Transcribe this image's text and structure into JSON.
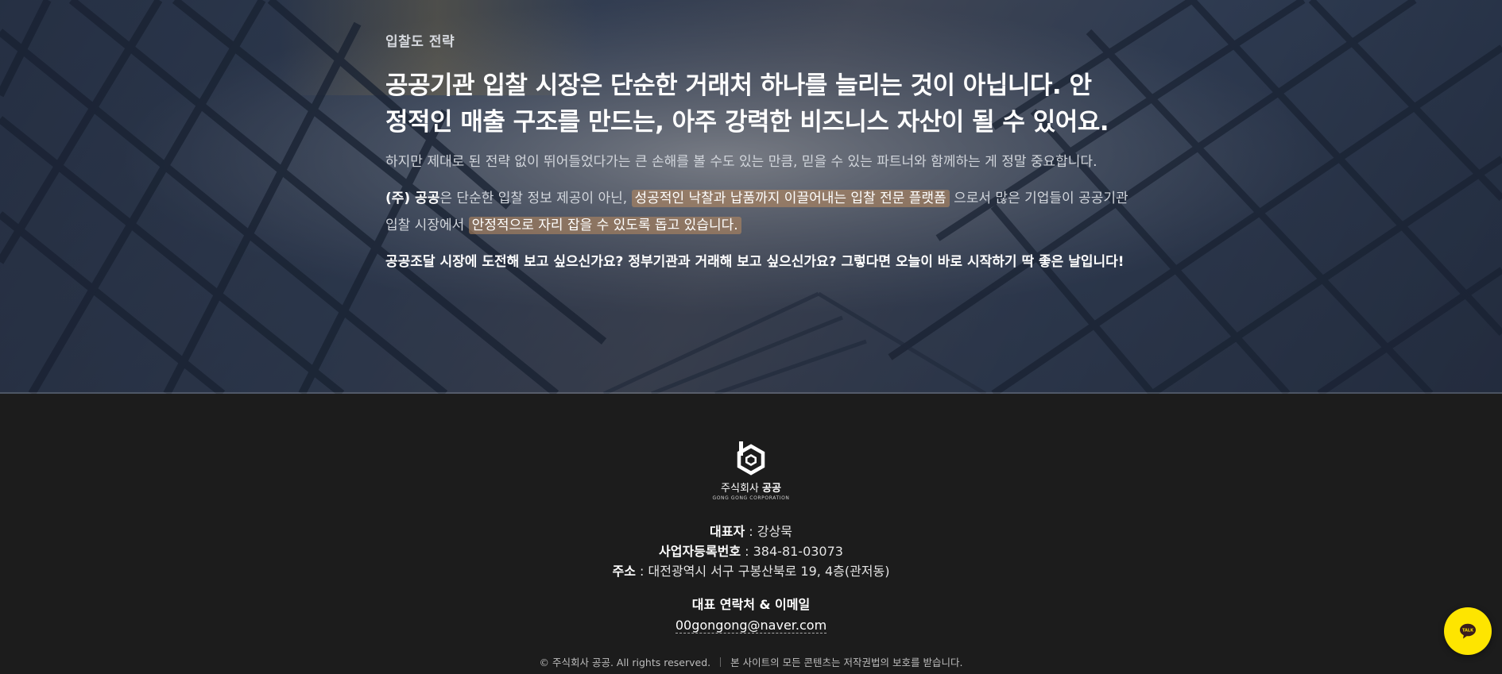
{
  "hero": {
    "eyebrow": "입찰도 전략",
    "headline_line1": "공공기관 입찰 시장은 단순한 거래처 하나를 늘리는 것이 아닙니다. 안",
    "headline_line2": "정적인 매출 구조를 만드는, 아주 강력한 비즈니스 자산이 될 수 있어요.",
    "subtext": "하지만 제대로 된 전략 없이 뛰어들었다가는 큰 손해를 볼 수도 있는 만큼, 믿을 수 있는 파트너와 함께하는 게 정말 중요합니다.",
    "para_company": "(주) 공공",
    "para_part1": "은 단순한 입찰 정보 제공이 아닌,",
    "para_highlight1": "성공적인 낙찰과 납품까지 이끌어내는 입찰 전문 플랫폼",
    "para_part2": "으로서 많은 기업들이 공공기관",
    "para_part3": "입찰 시장에서",
    "para_highlight2": "안정적으로 자리 잡을 수 있도록 돕고 있습니다.",
    "cta": "공공조달 시장에 도전해 보고 싶으신가요? 정부기관과 거래해 보고 싶으신가요? 그렇다면 오늘이 바로 시작하기 딱 좋은 날입니다!"
  },
  "footer": {
    "logo_name_prefix": "주식회사",
    "logo_name_bold": "공공",
    "logo_sub": "GONG GONG CORPORATION",
    "ceo_label": "대표자",
    "ceo_value": " : 강상묵",
    "bizno_label": "사업자등록번호",
    "bizno_value": " : 384-81-03073",
    "address_label": "주소",
    "address_value": " : 대전광역시 서구 구봉산북로 19, 4층(관저동)",
    "contact_title": "대표 연락처 & 이메일",
    "email": "00gongong@naver.com",
    "copyright": "© 주식회사 공공. All rights reserved.",
    "copyright_note": "본 사이트의 모든 콘텐츠는 저작권법의 보호를 받습니다."
  },
  "chat": {
    "label": "TALK",
    "icon": "chat-bubble-icon",
    "color": "#fee500"
  },
  "colors": {
    "footer_bg": "#1c1c1c",
    "highlight": "#be8c5f"
  }
}
